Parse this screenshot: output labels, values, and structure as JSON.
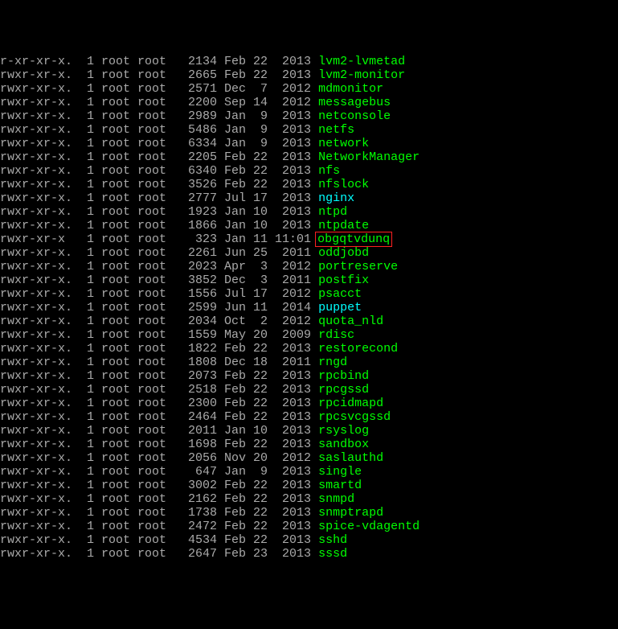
{
  "rows": [
    {
      "perm": "r-xr-xr-x.",
      "links": "1",
      "owner": "root",
      "group": "root",
      "size": "2134",
      "month": "Feb",
      "day": "22",
      "time": "2013",
      "name": "lvm2-lvmetad",
      "color": "green",
      "hl": false
    },
    {
      "perm": "rwxr-xr-x.",
      "links": "1",
      "owner": "root",
      "group": "root",
      "size": "2665",
      "month": "Feb",
      "day": "22",
      "time": "2013",
      "name": "lvm2-monitor",
      "color": "green",
      "hl": false
    },
    {
      "perm": "rwxr-xr-x.",
      "links": "1",
      "owner": "root",
      "group": "root",
      "size": "2571",
      "month": "Dec",
      "day": "7",
      "time": "2012",
      "name": "mdmonitor",
      "color": "green",
      "hl": false
    },
    {
      "perm": "rwxr-xr-x.",
      "links": "1",
      "owner": "root",
      "group": "root",
      "size": "2200",
      "month": "Sep",
      "day": "14",
      "time": "2012",
      "name": "messagebus",
      "color": "green",
      "hl": false
    },
    {
      "perm": "rwxr-xr-x.",
      "links": "1",
      "owner": "root",
      "group": "root",
      "size": "2989",
      "month": "Jan",
      "day": "9",
      "time": "2013",
      "name": "netconsole",
      "color": "green",
      "hl": false
    },
    {
      "perm": "rwxr-xr-x.",
      "links": "1",
      "owner": "root",
      "group": "root",
      "size": "5486",
      "month": "Jan",
      "day": "9",
      "time": "2013",
      "name": "netfs",
      "color": "green",
      "hl": false
    },
    {
      "perm": "rwxr-xr-x.",
      "links": "1",
      "owner": "root",
      "group": "root",
      "size": "6334",
      "month": "Jan",
      "day": "9",
      "time": "2013",
      "name": "network",
      "color": "green",
      "hl": false
    },
    {
      "perm": "rwxr-xr-x.",
      "links": "1",
      "owner": "root",
      "group": "root",
      "size": "2205",
      "month": "Feb",
      "day": "22",
      "time": "2013",
      "name": "NetworkManager",
      "color": "green",
      "hl": false
    },
    {
      "perm": "rwxr-xr-x.",
      "links": "1",
      "owner": "root",
      "group": "root",
      "size": "6340",
      "month": "Feb",
      "day": "22",
      "time": "2013",
      "name": "nfs",
      "color": "green",
      "hl": false
    },
    {
      "perm": "rwxr-xr-x.",
      "links": "1",
      "owner": "root",
      "group": "root",
      "size": "3526",
      "month": "Feb",
      "day": "22",
      "time": "2013",
      "name": "nfslock",
      "color": "green",
      "hl": false
    },
    {
      "perm": "rwxr-xr-x.",
      "links": "1",
      "owner": "root",
      "group": "root",
      "size": "2777",
      "month": "Jul",
      "day": "17",
      "time": "2013",
      "name": "nginx",
      "color": "cyan",
      "hl": false
    },
    {
      "perm": "rwxr-xr-x.",
      "links": "1",
      "owner": "root",
      "group": "root",
      "size": "1923",
      "month": "Jan",
      "day": "10",
      "time": "2013",
      "name": "ntpd",
      "color": "green",
      "hl": false
    },
    {
      "perm": "rwxr-xr-x.",
      "links": "1",
      "owner": "root",
      "group": "root",
      "size": "1866",
      "month": "Jan",
      "day": "10",
      "time": "2013",
      "name": "ntpdate",
      "color": "green",
      "hl": false
    },
    {
      "perm": "rwxr-xr-x",
      "links": "1",
      "owner": "root",
      "group": "root",
      "size": "323",
      "month": "Jan",
      "day": "11",
      "time": "11:01",
      "name": "obgqtvdunq",
      "color": "green",
      "hl": true
    },
    {
      "perm": "rwxr-xr-x.",
      "links": "1",
      "owner": "root",
      "group": "root",
      "size": "2261",
      "month": "Jun",
      "day": "25",
      "time": "2011",
      "name": "oddjobd",
      "color": "green",
      "hl": false
    },
    {
      "perm": "rwxr-xr-x.",
      "links": "1",
      "owner": "root",
      "group": "root",
      "size": "2023",
      "month": "Apr",
      "day": "3",
      "time": "2012",
      "name": "portreserve",
      "color": "green",
      "hl": false
    },
    {
      "perm": "rwxr-xr-x.",
      "links": "1",
      "owner": "root",
      "group": "root",
      "size": "3852",
      "month": "Dec",
      "day": "3",
      "time": "2011",
      "name": "postfix",
      "color": "green",
      "hl": false
    },
    {
      "perm": "rwxr-xr-x.",
      "links": "1",
      "owner": "root",
      "group": "root",
      "size": "1556",
      "month": "Jul",
      "day": "17",
      "time": "2012",
      "name": "psacct",
      "color": "green",
      "hl": false
    },
    {
      "perm": "rwxr-xr-x.",
      "links": "1",
      "owner": "root",
      "group": "root",
      "size": "2599",
      "month": "Jun",
      "day": "11",
      "time": "2014",
      "name": "puppet",
      "color": "cyan",
      "hl": false
    },
    {
      "perm": "rwxr-xr-x.",
      "links": "1",
      "owner": "root",
      "group": "root",
      "size": "2034",
      "month": "Oct",
      "day": "2",
      "time": "2012",
      "name": "quota_nld",
      "color": "green",
      "hl": false
    },
    {
      "perm": "rwxr-xr-x.",
      "links": "1",
      "owner": "root",
      "group": "root",
      "size": "1559",
      "month": "May",
      "day": "20",
      "time": "2009",
      "name": "rdisc",
      "color": "green",
      "hl": false
    },
    {
      "perm": "rwxr-xr-x.",
      "links": "1",
      "owner": "root",
      "group": "root",
      "size": "1822",
      "month": "Feb",
      "day": "22",
      "time": "2013",
      "name": "restorecond",
      "color": "green",
      "hl": false
    },
    {
      "perm": "rwxr-xr-x.",
      "links": "1",
      "owner": "root",
      "group": "root",
      "size": "1808",
      "month": "Dec",
      "day": "18",
      "time": "2011",
      "name": "rngd",
      "color": "green",
      "hl": false
    },
    {
      "perm": "rwxr-xr-x.",
      "links": "1",
      "owner": "root",
      "group": "root",
      "size": "2073",
      "month": "Feb",
      "day": "22",
      "time": "2013",
      "name": "rpcbind",
      "color": "green",
      "hl": false
    },
    {
      "perm": "rwxr-xr-x.",
      "links": "1",
      "owner": "root",
      "group": "root",
      "size": "2518",
      "month": "Feb",
      "day": "22",
      "time": "2013",
      "name": "rpcgssd",
      "color": "green",
      "hl": false
    },
    {
      "perm": "rwxr-xr-x.",
      "links": "1",
      "owner": "root",
      "group": "root",
      "size": "2300",
      "month": "Feb",
      "day": "22",
      "time": "2013",
      "name": "rpcidmapd",
      "color": "green",
      "hl": false
    },
    {
      "perm": "rwxr-xr-x.",
      "links": "1",
      "owner": "root",
      "group": "root",
      "size": "2464",
      "month": "Feb",
      "day": "22",
      "time": "2013",
      "name": "rpcsvcgssd",
      "color": "green",
      "hl": false
    },
    {
      "perm": "rwxr-xr-x.",
      "links": "1",
      "owner": "root",
      "group": "root",
      "size": "2011",
      "month": "Jan",
      "day": "10",
      "time": "2013",
      "name": "rsyslog",
      "color": "green",
      "hl": false
    },
    {
      "perm": "rwxr-xr-x.",
      "links": "1",
      "owner": "root",
      "group": "root",
      "size": "1698",
      "month": "Feb",
      "day": "22",
      "time": "2013",
      "name": "sandbox",
      "color": "green",
      "hl": false
    },
    {
      "perm": "rwxr-xr-x.",
      "links": "1",
      "owner": "root",
      "group": "root",
      "size": "2056",
      "month": "Nov",
      "day": "20",
      "time": "2012",
      "name": "saslauthd",
      "color": "green",
      "hl": false
    },
    {
      "perm": "rwxr-xr-x.",
      "links": "1",
      "owner": "root",
      "group": "root",
      "size": "647",
      "month": "Jan",
      "day": "9",
      "time": "2013",
      "name": "single",
      "color": "green",
      "hl": false
    },
    {
      "perm": "rwxr-xr-x.",
      "links": "1",
      "owner": "root",
      "group": "root",
      "size": "3002",
      "month": "Feb",
      "day": "22",
      "time": "2013",
      "name": "smartd",
      "color": "green",
      "hl": false
    },
    {
      "perm": "rwxr-xr-x.",
      "links": "1",
      "owner": "root",
      "group": "root",
      "size": "2162",
      "month": "Feb",
      "day": "22",
      "time": "2013",
      "name": "snmpd",
      "color": "green",
      "hl": false
    },
    {
      "perm": "rwxr-xr-x.",
      "links": "1",
      "owner": "root",
      "group": "root",
      "size": "1738",
      "month": "Feb",
      "day": "22",
      "time": "2013",
      "name": "snmptrapd",
      "color": "green",
      "hl": false
    },
    {
      "perm": "rwxr-xr-x.",
      "links": "1",
      "owner": "root",
      "group": "root",
      "size": "2472",
      "month": "Feb",
      "day": "22",
      "time": "2013",
      "name": "spice-vdagentd",
      "color": "green",
      "hl": false
    },
    {
      "perm": "rwxr-xr-x.",
      "links": "1",
      "owner": "root",
      "group": "root",
      "size": "4534",
      "month": "Feb",
      "day": "22",
      "time": "2013",
      "name": "sshd",
      "color": "green",
      "hl": false
    },
    {
      "perm": "rwxr-xr-x.",
      "links": "1",
      "owner": "root",
      "group": "root",
      "size": "2647",
      "month": "Feb",
      "day": "23",
      "time": "2013",
      "name": "sssd",
      "color": "green",
      "hl": false
    }
  ]
}
